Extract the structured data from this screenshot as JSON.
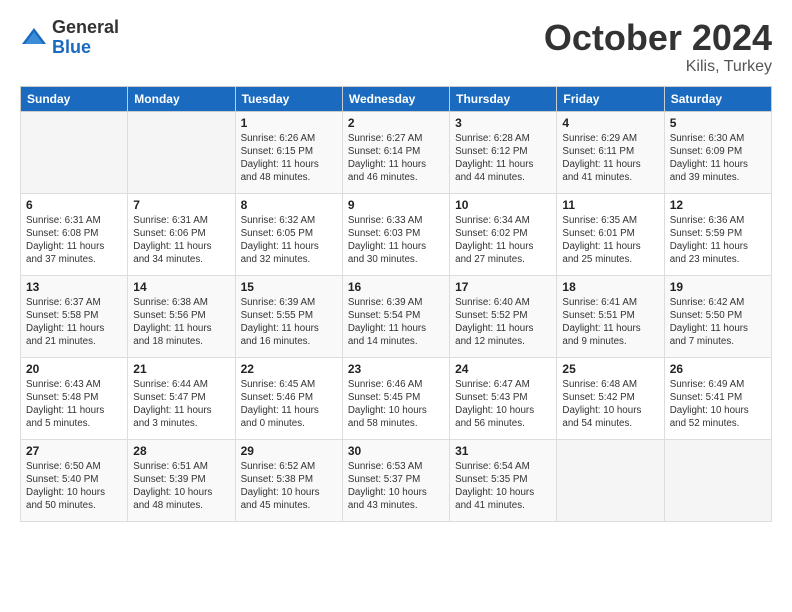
{
  "logo": {
    "general": "General",
    "blue": "Blue"
  },
  "header": {
    "month": "October 2024",
    "location": "Kilis, Turkey"
  },
  "days_of_week": [
    "Sunday",
    "Monday",
    "Tuesday",
    "Wednesday",
    "Thursday",
    "Friday",
    "Saturday"
  ],
  "weeks": [
    [
      {
        "day": "",
        "info": ""
      },
      {
        "day": "",
        "info": ""
      },
      {
        "day": "1",
        "info": "Sunrise: 6:26 AM\nSunset: 6:15 PM\nDaylight: 11 hours and 48 minutes."
      },
      {
        "day": "2",
        "info": "Sunrise: 6:27 AM\nSunset: 6:14 PM\nDaylight: 11 hours and 46 minutes."
      },
      {
        "day": "3",
        "info": "Sunrise: 6:28 AM\nSunset: 6:12 PM\nDaylight: 11 hours and 44 minutes."
      },
      {
        "day": "4",
        "info": "Sunrise: 6:29 AM\nSunset: 6:11 PM\nDaylight: 11 hours and 41 minutes."
      },
      {
        "day": "5",
        "info": "Sunrise: 6:30 AM\nSunset: 6:09 PM\nDaylight: 11 hours and 39 minutes."
      }
    ],
    [
      {
        "day": "6",
        "info": "Sunrise: 6:31 AM\nSunset: 6:08 PM\nDaylight: 11 hours and 37 minutes."
      },
      {
        "day": "7",
        "info": "Sunrise: 6:31 AM\nSunset: 6:06 PM\nDaylight: 11 hours and 34 minutes."
      },
      {
        "day": "8",
        "info": "Sunrise: 6:32 AM\nSunset: 6:05 PM\nDaylight: 11 hours and 32 minutes."
      },
      {
        "day": "9",
        "info": "Sunrise: 6:33 AM\nSunset: 6:03 PM\nDaylight: 11 hours and 30 minutes."
      },
      {
        "day": "10",
        "info": "Sunrise: 6:34 AM\nSunset: 6:02 PM\nDaylight: 11 hours and 27 minutes."
      },
      {
        "day": "11",
        "info": "Sunrise: 6:35 AM\nSunset: 6:01 PM\nDaylight: 11 hours and 25 minutes."
      },
      {
        "day": "12",
        "info": "Sunrise: 6:36 AM\nSunset: 5:59 PM\nDaylight: 11 hours and 23 minutes."
      }
    ],
    [
      {
        "day": "13",
        "info": "Sunrise: 6:37 AM\nSunset: 5:58 PM\nDaylight: 11 hours and 21 minutes."
      },
      {
        "day": "14",
        "info": "Sunrise: 6:38 AM\nSunset: 5:56 PM\nDaylight: 11 hours and 18 minutes."
      },
      {
        "day": "15",
        "info": "Sunrise: 6:39 AM\nSunset: 5:55 PM\nDaylight: 11 hours and 16 minutes."
      },
      {
        "day": "16",
        "info": "Sunrise: 6:39 AM\nSunset: 5:54 PM\nDaylight: 11 hours and 14 minutes."
      },
      {
        "day": "17",
        "info": "Sunrise: 6:40 AM\nSunset: 5:52 PM\nDaylight: 11 hours and 12 minutes."
      },
      {
        "day": "18",
        "info": "Sunrise: 6:41 AM\nSunset: 5:51 PM\nDaylight: 11 hours and 9 minutes."
      },
      {
        "day": "19",
        "info": "Sunrise: 6:42 AM\nSunset: 5:50 PM\nDaylight: 11 hours and 7 minutes."
      }
    ],
    [
      {
        "day": "20",
        "info": "Sunrise: 6:43 AM\nSunset: 5:48 PM\nDaylight: 11 hours and 5 minutes."
      },
      {
        "day": "21",
        "info": "Sunrise: 6:44 AM\nSunset: 5:47 PM\nDaylight: 11 hours and 3 minutes."
      },
      {
        "day": "22",
        "info": "Sunrise: 6:45 AM\nSunset: 5:46 PM\nDaylight: 11 hours and 0 minutes."
      },
      {
        "day": "23",
        "info": "Sunrise: 6:46 AM\nSunset: 5:45 PM\nDaylight: 10 hours and 58 minutes."
      },
      {
        "day": "24",
        "info": "Sunrise: 6:47 AM\nSunset: 5:43 PM\nDaylight: 10 hours and 56 minutes."
      },
      {
        "day": "25",
        "info": "Sunrise: 6:48 AM\nSunset: 5:42 PM\nDaylight: 10 hours and 54 minutes."
      },
      {
        "day": "26",
        "info": "Sunrise: 6:49 AM\nSunset: 5:41 PM\nDaylight: 10 hours and 52 minutes."
      }
    ],
    [
      {
        "day": "27",
        "info": "Sunrise: 6:50 AM\nSunset: 5:40 PM\nDaylight: 10 hours and 50 minutes."
      },
      {
        "day": "28",
        "info": "Sunrise: 6:51 AM\nSunset: 5:39 PM\nDaylight: 10 hours and 48 minutes."
      },
      {
        "day": "29",
        "info": "Sunrise: 6:52 AM\nSunset: 5:38 PM\nDaylight: 10 hours and 45 minutes."
      },
      {
        "day": "30",
        "info": "Sunrise: 6:53 AM\nSunset: 5:37 PM\nDaylight: 10 hours and 43 minutes."
      },
      {
        "day": "31",
        "info": "Sunrise: 6:54 AM\nSunset: 5:35 PM\nDaylight: 10 hours and 41 minutes."
      },
      {
        "day": "",
        "info": ""
      },
      {
        "day": "",
        "info": ""
      }
    ]
  ]
}
